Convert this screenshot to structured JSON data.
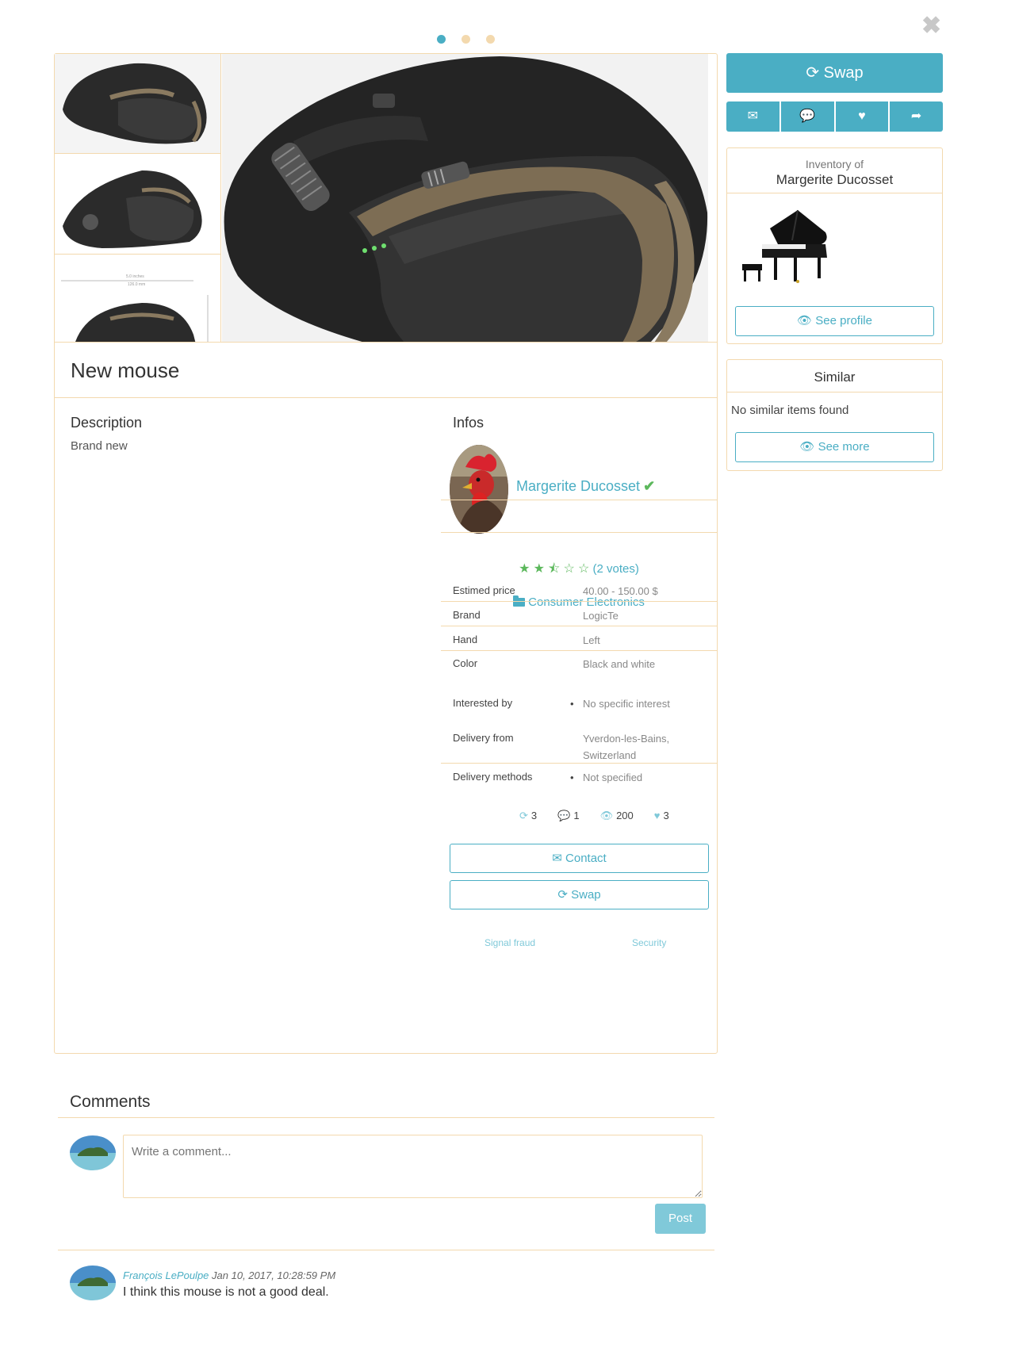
{
  "carousel": {
    "dot_colors": [
      "#4aaec4",
      "#f3d9ae",
      "#f3d9ae"
    ]
  },
  "item": {
    "title": "New mouse",
    "description_heading": "Description",
    "description": "Brand new",
    "infos_heading": "Infos",
    "owner_name": "Margerite Ducosset",
    "rating": 2.5,
    "votes_label": "(2 votes)",
    "category": "Consumer Electronics",
    "details": [
      {
        "key": "Estimed price",
        "value": "40.00 - 150.00 $"
      },
      {
        "key": "Brand",
        "value": "LogicTe"
      },
      {
        "key": "Hand",
        "value": "Left"
      },
      {
        "key": "Color",
        "value": "Black and white"
      },
      {
        "key": "Interested by",
        "value": "No specific interest"
      },
      {
        "key": "Delivery from",
        "value": "Yverdon-les-Bains,",
        "value2": "Switzerland"
      },
      {
        "key": "Delivery methods",
        "value": "Not specified"
      }
    ],
    "stats": {
      "swaps": "3",
      "comments": "1",
      "views": "200",
      "likes": "3"
    },
    "contact_label": "Contact",
    "swap_label": "Swap",
    "signal_fraud": "Signal fraud",
    "security": "Security"
  },
  "sidebar": {
    "swap_label": "Swap",
    "inventory_of": "Inventory of",
    "inventory_owner": "Margerite Ducosset",
    "see_profile": "See profile",
    "similar_title": "Similar",
    "similar_empty": "No similar items found",
    "see_more": "See more"
  },
  "comments": {
    "title": "Comments",
    "placeholder": "Write a comment...",
    "post_label": "Post",
    "list": [
      {
        "author": "François LePoulpe",
        "date": "Jan 10, 2017, 10:28:59 PM",
        "text": "I think this mouse is not a good deal."
      }
    ]
  },
  "colors": {
    "accent": "#4aaec4",
    "border": "#f3d9ae",
    "star": "#5cb85c"
  }
}
